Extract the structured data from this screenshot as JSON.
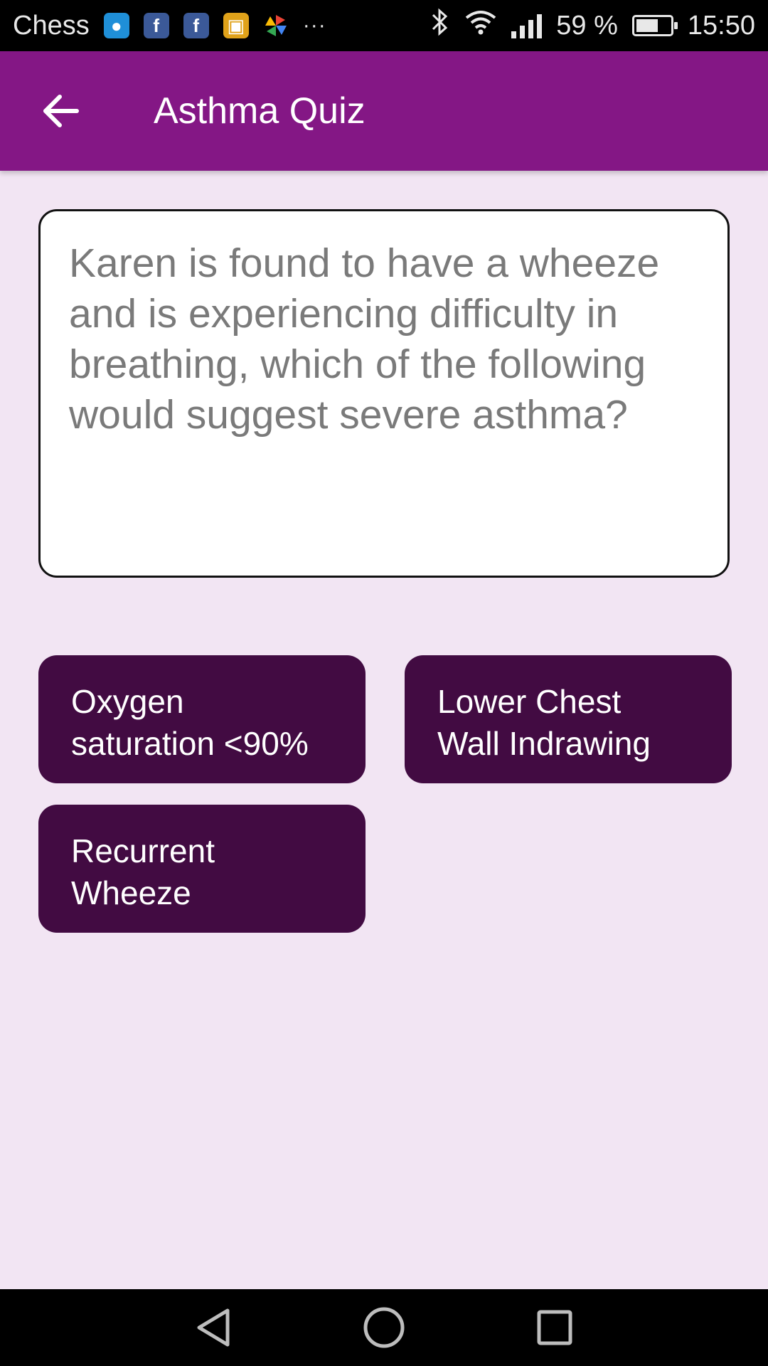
{
  "status_bar": {
    "carrier": "Chess",
    "notification_icons": [
      "message-icon",
      "facebook-icon",
      "facebook-icon",
      "shopping-bag-icon",
      "pinwheel-icon"
    ],
    "more": "···",
    "battery_percent": "59 %",
    "time": "15:50"
  },
  "app_bar": {
    "title": "Asthma Quiz",
    "back_icon": "arrow-back-icon",
    "background": "#841785"
  },
  "question": {
    "text": "Karen is found to have a wheeze and is experiencing difficulty in breathing, which of the following would suggest severe asthma?"
  },
  "answers": [
    {
      "label_line1": "Oxygen",
      "label_line2": "saturation <90%"
    },
    {
      "label_line1": "Lower Chest",
      "label_line2": "Wall Indrawing"
    },
    {
      "label_line1": "Recurrent",
      "label_line2": "Wheeze"
    }
  ],
  "colors": {
    "page_background": "#F2E5F3",
    "answer_button": "#420B42",
    "question_text": "#7A7A7A"
  },
  "nav_bar": {
    "icons": [
      "nav-back-icon",
      "nav-home-icon",
      "nav-recents-icon"
    ]
  }
}
